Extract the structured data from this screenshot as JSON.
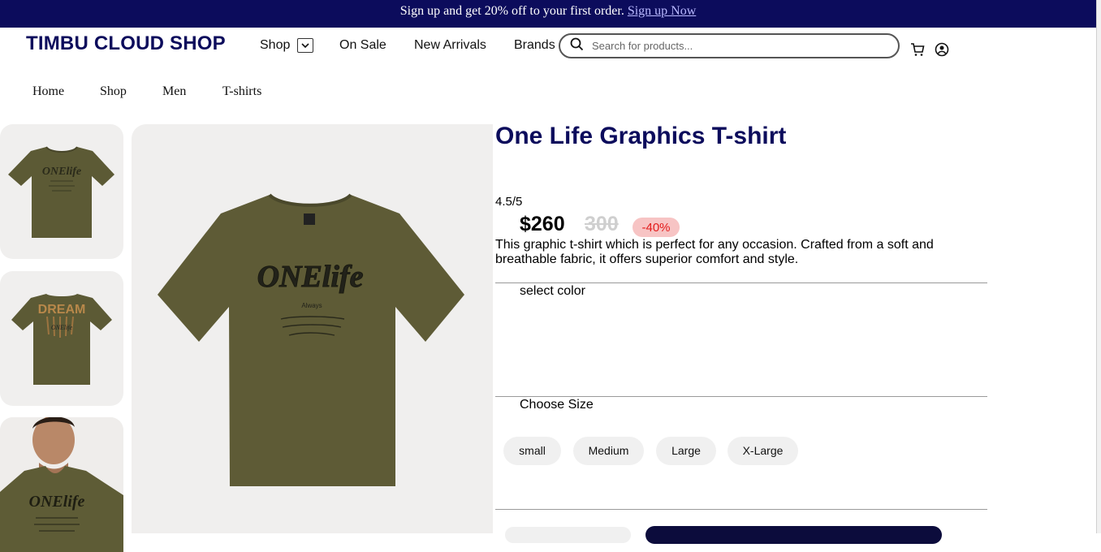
{
  "promo": {
    "text": "Sign up and get 20% off to your first order.",
    "link": "Sign up Now"
  },
  "header": {
    "logo": "TIMBU CLOUD SHOP",
    "nav": {
      "shop": "Shop",
      "on_sale": "On Sale",
      "new_arrivals": "New Arrivals",
      "brands": "Brands"
    },
    "search_placeholder": "Search for products...",
    "icons": [
      "search-icon",
      "cart-icon",
      "user-icon",
      "chevron-down-icon"
    ]
  },
  "breadcrumb": [
    "Home",
    "Shop",
    "Men",
    "T-shirts"
  ],
  "product": {
    "title": "One Life Graphics T-shirt",
    "rating": "4.5/5",
    "price": "$260",
    "old_price": "300",
    "discount": "-40%",
    "description": "This graphic t-shirt which is perfect for any occasion. Crafted from a soft and breathable fabric, it offers superior comfort and style.",
    "color_label": "select color",
    "size_label": "Choose Size",
    "sizes": [
      "small",
      "Medium",
      "Large",
      "X-Large"
    ],
    "shirt_color": "#5c5a35",
    "print_text": "ONElife"
  },
  "colors": {
    "brand": "#0c0c5c",
    "discount_bg": "#f7c4c4",
    "discount_text": "#e31b1b",
    "panel": "#f0efee"
  }
}
